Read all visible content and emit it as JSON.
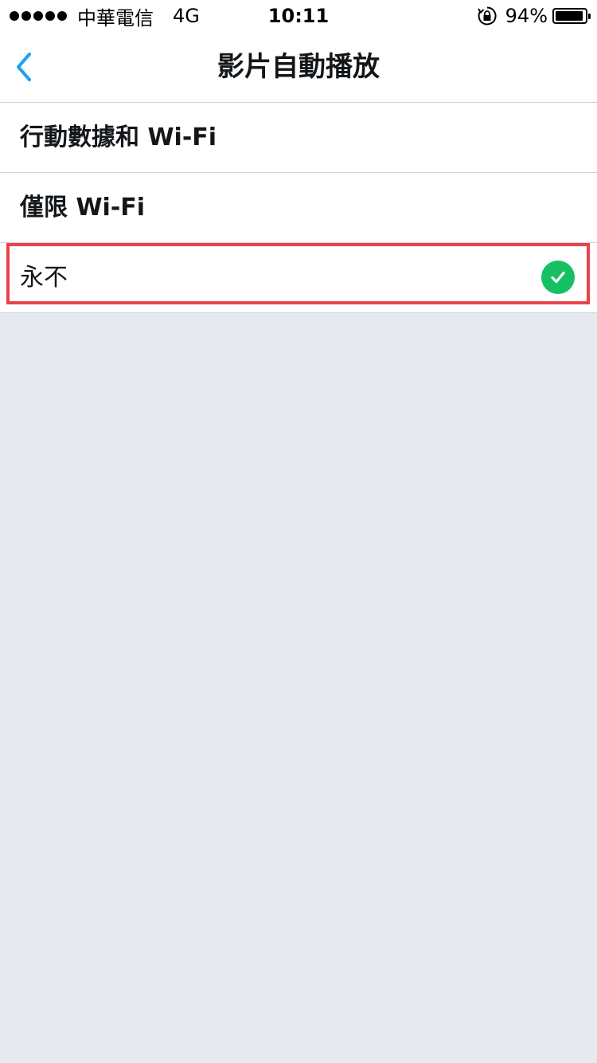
{
  "status_bar": {
    "carrier": "中華電信",
    "network": "4G",
    "time": "10:11",
    "battery": "94%",
    "battery_level": 0.94,
    "signal_dots": 5,
    "lock_icon": "orientation-lock-icon"
  },
  "nav": {
    "title": "影片自動播放",
    "back_icon": "chevron-left-icon"
  },
  "options": [
    {
      "label": "行動數據和 Wi-Fi",
      "selected": false
    },
    {
      "label": "僅限 Wi-Fi",
      "selected": false
    },
    {
      "label": "永不",
      "selected": true
    }
  ],
  "colors": {
    "accent": "#1da1f2",
    "check": "#17bf63",
    "highlight": "#e8424b",
    "background": "#e6eaee"
  }
}
